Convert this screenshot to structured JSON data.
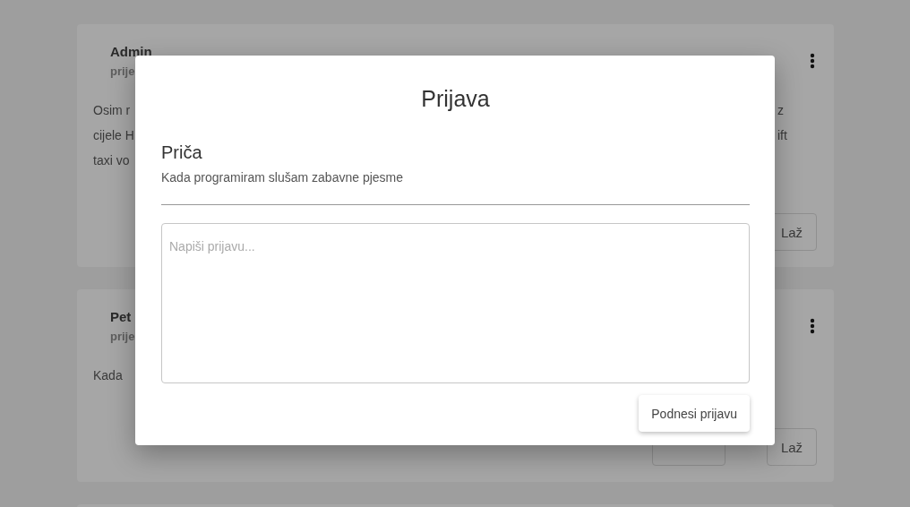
{
  "cards": [
    {
      "author": "Admin",
      "meta": "prije",
      "body_left": [
        "Osim r",
        "cijele H",
        "taxi vo"
      ],
      "body_right": [
        "z",
        "ift"
      ],
      "votes": [
        {
          "kind": "button",
          "text": "Laž"
        }
      ]
    },
    {
      "author": "Pet",
      "meta": "prije",
      "body_left": [
        "Kada"
      ],
      "votes": [
        {
          "kind": "hidden_button"
        },
        {
          "kind": "button",
          "text": "Laž"
        }
      ]
    }
  ],
  "modal": {
    "title": "Prijava",
    "story_heading": "Priča",
    "story_text": "Kada programiram slušam zabavne pjesme",
    "textarea": {
      "placeholder": "Napiši prijavu..."
    },
    "submit": "Podnesi prijavu"
  }
}
